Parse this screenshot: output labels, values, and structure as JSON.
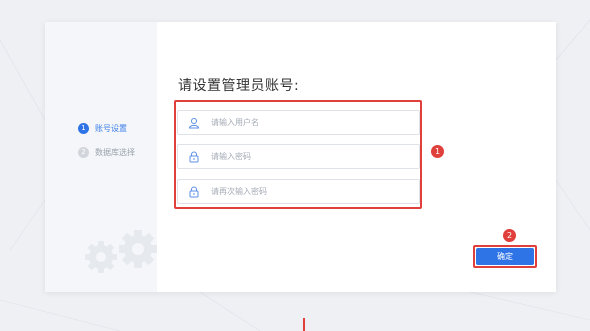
{
  "steps": [
    {
      "num": "1",
      "label": "账号设置"
    },
    {
      "num": "2",
      "label": "数据库选择"
    }
  ],
  "form": {
    "title": "请设置管理员账号:",
    "username_placeholder": "请输入用户名",
    "password_placeholder": "请输入密码",
    "confirm_password_placeholder": "请再次输入密码"
  },
  "confirm_button": "确定",
  "annotations": {
    "badge1": "1",
    "badge2": "2"
  },
  "colors": {
    "primary": "#2f74e6",
    "highlight": "#e0403c",
    "sidebar": "#f4f6f9"
  },
  "icons": {
    "username": "user-icon",
    "password": "lock-icon",
    "confirm_password": "lock-icon"
  }
}
